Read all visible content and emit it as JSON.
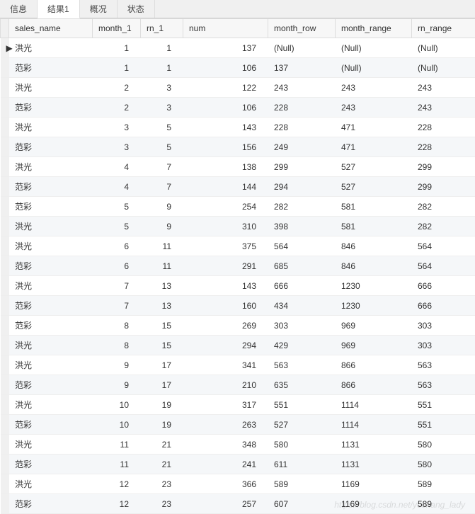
{
  "tabs": {
    "info": "信息",
    "result1": "结果1",
    "overview": "概况",
    "status": "状态"
  },
  "headers": {
    "sales_name": "sales_name",
    "month_1": "month_1",
    "rn_1": "rn_1",
    "num": "num",
    "month_row": "month_row",
    "month_range": "month_range",
    "rn_range": "rn_range"
  },
  "null_text": "(Null)",
  "watermark": "https://blog.csdn.net/yeshang_lady",
  "rows": [
    {
      "sales_name": "洪光",
      "month_1": 1,
      "rn_1": 1,
      "num": 137,
      "month_row": null,
      "month_range": null,
      "rn_range": null
    },
    {
      "sales_name": "范彩",
      "month_1": 1,
      "rn_1": 1,
      "num": 106,
      "month_row": 137,
      "month_range": null,
      "rn_range": null
    },
    {
      "sales_name": "洪光",
      "month_1": 2,
      "rn_1": 3,
      "num": 122,
      "month_row": 243,
      "month_range": 243,
      "rn_range": 243
    },
    {
      "sales_name": "范彩",
      "month_1": 2,
      "rn_1": 3,
      "num": 106,
      "month_row": 228,
      "month_range": 243,
      "rn_range": 243
    },
    {
      "sales_name": "洪光",
      "month_1": 3,
      "rn_1": 5,
      "num": 143,
      "month_row": 228,
      "month_range": 471,
      "rn_range": 228
    },
    {
      "sales_name": "范彩",
      "month_1": 3,
      "rn_1": 5,
      "num": 156,
      "month_row": 249,
      "month_range": 471,
      "rn_range": 228
    },
    {
      "sales_name": "洪光",
      "month_1": 4,
      "rn_1": 7,
      "num": 138,
      "month_row": 299,
      "month_range": 527,
      "rn_range": 299
    },
    {
      "sales_name": "范彩",
      "month_1": 4,
      "rn_1": 7,
      "num": 144,
      "month_row": 294,
      "month_range": 527,
      "rn_range": 299
    },
    {
      "sales_name": "范彩",
      "month_1": 5,
      "rn_1": 9,
      "num": 254,
      "month_row": 282,
      "month_range": 581,
      "rn_range": 282
    },
    {
      "sales_name": "洪光",
      "month_1": 5,
      "rn_1": 9,
      "num": 310,
      "month_row": 398,
      "month_range": 581,
      "rn_range": 282
    },
    {
      "sales_name": "洪光",
      "month_1": 6,
      "rn_1": 11,
      "num": 375,
      "month_row": 564,
      "month_range": 846,
      "rn_range": 564
    },
    {
      "sales_name": "范彩",
      "month_1": 6,
      "rn_1": 11,
      "num": 291,
      "month_row": 685,
      "month_range": 846,
      "rn_range": 564
    },
    {
      "sales_name": "洪光",
      "month_1": 7,
      "rn_1": 13,
      "num": 143,
      "month_row": 666,
      "month_range": 1230,
      "rn_range": 666
    },
    {
      "sales_name": "范彩",
      "month_1": 7,
      "rn_1": 13,
      "num": 160,
      "month_row": 434,
      "month_range": 1230,
      "rn_range": 666
    },
    {
      "sales_name": "范彩",
      "month_1": 8,
      "rn_1": 15,
      "num": 269,
      "month_row": 303,
      "month_range": 969,
      "rn_range": 303
    },
    {
      "sales_name": "洪光",
      "month_1": 8,
      "rn_1": 15,
      "num": 294,
      "month_row": 429,
      "month_range": 969,
      "rn_range": 303
    },
    {
      "sales_name": "洪光",
      "month_1": 9,
      "rn_1": 17,
      "num": 341,
      "month_row": 563,
      "month_range": 866,
      "rn_range": 563
    },
    {
      "sales_name": "范彩",
      "month_1": 9,
      "rn_1": 17,
      "num": 210,
      "month_row": 635,
      "month_range": 866,
      "rn_range": 563
    },
    {
      "sales_name": "洪光",
      "month_1": 10,
      "rn_1": 19,
      "num": 317,
      "month_row": 551,
      "month_range": 1114,
      "rn_range": 551
    },
    {
      "sales_name": "范彩",
      "month_1": 10,
      "rn_1": 19,
      "num": 263,
      "month_row": 527,
      "month_range": 1114,
      "rn_range": 551
    },
    {
      "sales_name": "洪光",
      "month_1": 11,
      "rn_1": 21,
      "num": 348,
      "month_row": 580,
      "month_range": 1131,
      "rn_range": 580
    },
    {
      "sales_name": "范彩",
      "month_1": 11,
      "rn_1": 21,
      "num": 241,
      "month_row": 611,
      "month_range": 1131,
      "rn_range": 580
    },
    {
      "sales_name": "洪光",
      "month_1": 12,
      "rn_1": 23,
      "num": 366,
      "month_row": 589,
      "month_range": 1169,
      "rn_range": 589
    },
    {
      "sales_name": "范彩",
      "month_1": 12,
      "rn_1": 23,
      "num": 257,
      "month_row": 607,
      "month_range": 1169,
      "rn_range": 589
    }
  ]
}
